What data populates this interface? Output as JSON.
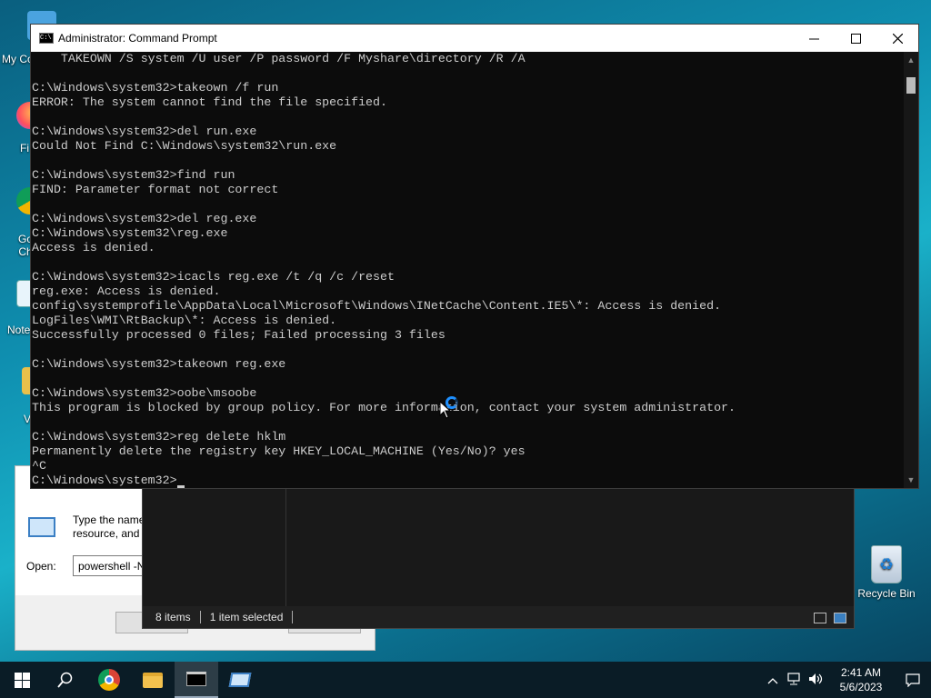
{
  "desktop": {
    "icons": [
      {
        "label": "My Co",
        "name": "my-computer-icon"
      },
      {
        "label": "Fi",
        "name": "firefox-icon"
      },
      {
        "label": "Go Ch",
        "name": "chrome-icon"
      },
      {
        "label": "Note",
        "name": "notepad-icon"
      },
      {
        "label": "V",
        "name": "folder-icon"
      },
      {
        "label": "Recycle Bin",
        "name": "recycle-bin-icon"
      }
    ]
  },
  "run_dialog": {
    "description": "Type the name resource, and W",
    "desc_line1": "Type the name",
    "desc_line2": "resource, and W",
    "open_label": "Open:",
    "open_value": "powershell -N"
  },
  "explorer": {
    "items_count": "8 items",
    "selected": "1 item selected"
  },
  "cmd": {
    "title": "Administrator: Command Prompt",
    "lines": [
      "    TAKEOWN /S system /U user /P password /F Myshare\\directory /R /A",
      "",
      "C:\\Windows\\system32>takeown /f run",
      "ERROR: The system cannot find the file specified.",
      "",
      "C:\\Windows\\system32>del run.exe",
      "Could Not Find C:\\Windows\\system32\\run.exe",
      "",
      "C:\\Windows\\system32>find run",
      "FIND: Parameter format not correct",
      "",
      "C:\\Windows\\system32>del reg.exe",
      "C:\\Windows\\system32\\reg.exe",
      "Access is denied.",
      "",
      "C:\\Windows\\system32>icacls reg.exe /t /q /c /reset",
      "reg.exe: Access is denied.",
      "config\\systemprofile\\AppData\\Local\\Microsoft\\Windows\\INetCache\\Content.IE5\\*: Access is denied.",
      "LogFiles\\WMI\\RtBackup\\*: Access is denied.",
      "Successfully processed 0 files; Failed processing 3 files",
      "",
      "C:\\Windows\\system32>takeown reg.exe",
      "",
      "C:\\Windows\\system32>oobe\\msoobe",
      "This program is blocked by group policy. For more information, contact your system administrator.",
      "",
      "C:\\Windows\\system32>reg delete hklm",
      "Permanently delete the registry key HKEY_LOCAL_MACHINE (Yes/No)? yes",
      "^C"
    ],
    "prompt": "C:\\Windows\\system32>"
  },
  "taskbar": {
    "time": "2:41 AM",
    "date": "5/6/2023"
  },
  "colors": {
    "console_bg": "#0c0c0c",
    "console_text": "#cccccc",
    "taskbar_bg": "#0a1c26"
  }
}
